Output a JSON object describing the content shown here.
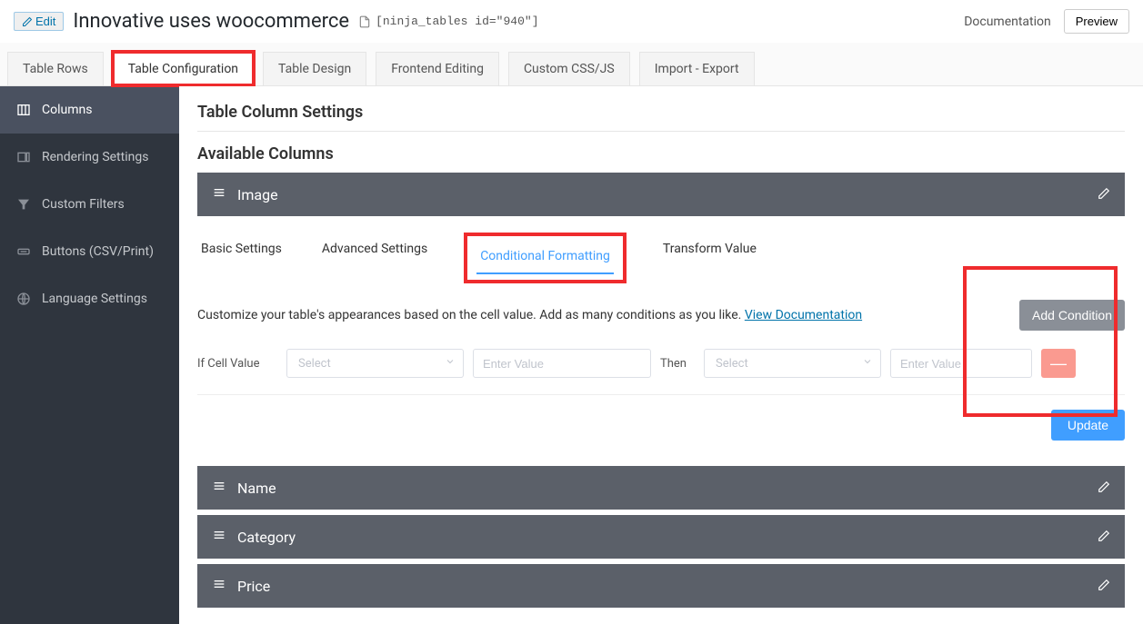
{
  "header": {
    "edit_label": "Edit",
    "title": "Innovative uses woocommerce",
    "shortcode": "[ninja_tables id=\"940\"]",
    "documentation": "Documentation",
    "preview": "Preview"
  },
  "main_tabs": [
    {
      "label": "Table Rows",
      "active": false
    },
    {
      "label": "Table Configuration",
      "active": true,
      "highlight": true
    },
    {
      "label": "Table Design",
      "active": false
    },
    {
      "label": "Frontend Editing",
      "active": false
    },
    {
      "label": "Custom CSS/JS",
      "active": false
    },
    {
      "label": "Import - Export",
      "active": false
    }
  ],
  "sidebar": {
    "items": [
      {
        "label": "Columns",
        "icon": "columns-icon",
        "active": true
      },
      {
        "label": "Rendering Settings",
        "icon": "rendering-icon",
        "active": false
      },
      {
        "label": "Custom Filters",
        "icon": "filter-icon",
        "active": false
      },
      {
        "label": "Buttons (CSV/Print)",
        "icon": "buttons-icon",
        "active": false
      },
      {
        "label": "Language Settings",
        "icon": "language-icon",
        "active": false
      }
    ]
  },
  "section": {
    "title": "Table Column Settings",
    "available_title": "Available Columns"
  },
  "columns": [
    {
      "name": "Image",
      "expanded": true
    },
    {
      "name": "Name",
      "expanded": false
    },
    {
      "name": "Category",
      "expanded": false
    },
    {
      "name": "Price",
      "expanded": false
    }
  ],
  "inner_tabs": [
    {
      "label": "Basic Settings",
      "active": false
    },
    {
      "label": "Advanced Settings",
      "active": false
    },
    {
      "label": "Conditional Formatting",
      "active": true,
      "highlight": true
    },
    {
      "label": "Transform Value",
      "active": false
    }
  ],
  "conditional": {
    "description": "Customize your table's appearances based on the cell value. Add as many conditions as you like.",
    "doc_link_text": "View Documentation",
    "add_button": "Add Condition",
    "if_label": "If Cell Value",
    "then_label": "Then",
    "select_placeholder": "Select",
    "value_placeholder": "Enter Value",
    "value2_placeholder": "Enter Value",
    "remove_symbol": "—",
    "update_button": "Update"
  }
}
